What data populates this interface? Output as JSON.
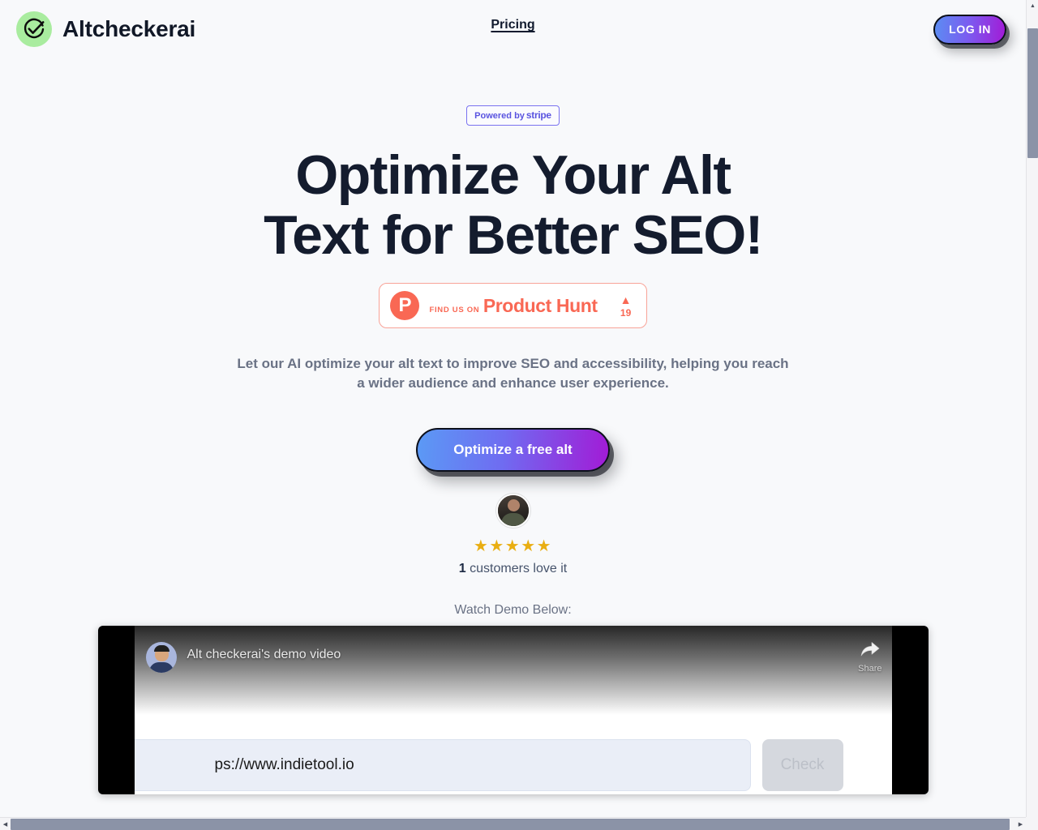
{
  "brand": {
    "name": "Altcheckerai",
    "logo_icon": "circle-check-icon",
    "logo_bg": "#a9ec9f"
  },
  "nav": {
    "pricing_label": "Pricing",
    "login_label": "LOG IN"
  },
  "hero": {
    "stripe_badge": {
      "prefix": "Powered by",
      "brand": "stripe",
      "border_color": "#7a73f0",
      "text_color": "#5a54e0"
    },
    "title": "Optimize Your Alt Text for Better SEO!",
    "product_hunt": {
      "logo_letter": "P",
      "eyebrow": "FIND US ON",
      "name": "Product Hunt",
      "upvote_icon": "triangle-up-icon",
      "votes": "19",
      "color": "#f96854"
    },
    "subtitle": "Let our AI optimize your alt text to improve SEO and accessibility, helping you reach a wider audience and enhance user experience.",
    "cta_label": "Optimize a free alt",
    "cta_gradient_from": "#5b9af5",
    "cta_gradient_to": "#a21bd6",
    "social_proof": {
      "avatar_icon": "customer-avatar",
      "stars": "★★★★★",
      "star_count": 5,
      "star_color": "#e9ae12",
      "count": "1",
      "caption": "customers love it"
    },
    "watch_label": "Watch Demo Below:"
  },
  "video": {
    "channel_avatar_icon": "channel-avatar",
    "title": "Alt checkerai's demo video",
    "share_icon": "share-arrow-icon",
    "share_label": "Share",
    "demo_form": {
      "input_value": "ps://www.indietool.io",
      "input_placeholder": "https://www.indietool.io",
      "check_label": "Check"
    }
  },
  "scrollbars": {
    "up_arrow": "▲",
    "down_arrow": "▼",
    "left_arrow": "◀",
    "right_arrow": "▶"
  }
}
